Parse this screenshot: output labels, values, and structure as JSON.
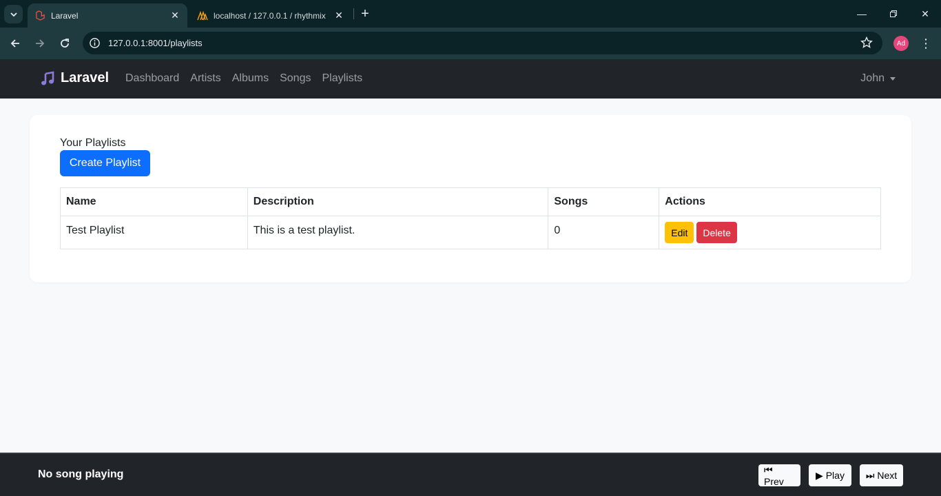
{
  "browser": {
    "tabs": [
      {
        "title": "Laravel",
        "active": true
      },
      {
        "title": "localhost / 127.0.0.1 / rhythmix",
        "active": false
      }
    ],
    "url": "127.0.0.1:8001/playlists",
    "profile_initials": "Ad"
  },
  "navbar": {
    "brand": "Laravel",
    "links": [
      "Dashboard",
      "Artists",
      "Albums",
      "Songs",
      "Playlists"
    ],
    "user": "John"
  },
  "main": {
    "heading": "Your Playlists",
    "create_button": "Create Playlist",
    "table": {
      "headers": [
        "Name",
        "Description",
        "Songs",
        "Actions"
      ],
      "rows": [
        {
          "name": "Test Playlist",
          "description": "This is a test playlist.",
          "songs": "0",
          "edit": "Edit",
          "delete": "Delete"
        }
      ]
    }
  },
  "player": {
    "status": "No song playing",
    "prev": "⏮ Prev",
    "play": "▶ Play",
    "next": "⏭ Next"
  },
  "colors": {
    "primary": "#0d6efd",
    "warning": "#ffc107",
    "danger": "#dc3545",
    "navbar_bg": "#212529"
  }
}
